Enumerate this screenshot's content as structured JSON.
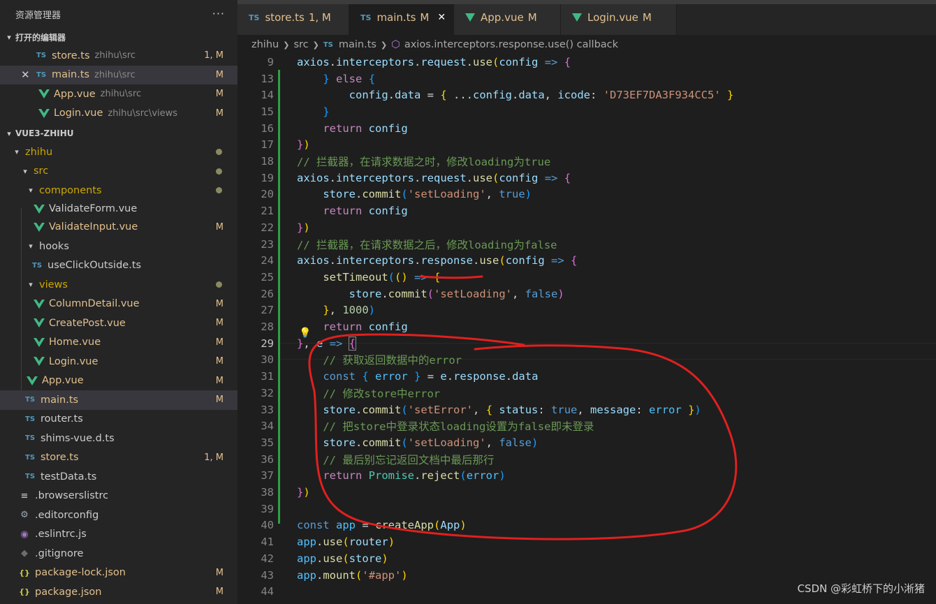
{
  "sidebar": {
    "title": "资源管理器",
    "more": "···",
    "open_editors": {
      "header": "打开的编辑器",
      "items": [
        {
          "type": "TS",
          "name": "store.ts",
          "path": "zhihu\\src",
          "status": "1, M",
          "icon": "ts-icon"
        },
        {
          "type": "TS",
          "name": "main.ts",
          "path": "zhihu\\src",
          "status": "M",
          "icon": "ts-icon",
          "close": "✕"
        },
        {
          "type": "vue",
          "name": "App.vue",
          "path": "zhihu\\src",
          "status": "M",
          "icon": "vue-icon"
        },
        {
          "type": "vue",
          "name": "Login.vue",
          "path": "zhihu\\src\\views",
          "status": "M",
          "icon": "vue-icon"
        }
      ]
    },
    "project": {
      "header": "VUE3-ZHIHU",
      "tree": [
        {
          "label": "zhihu",
          "kind": "folder"
        },
        {
          "label": "src",
          "kind": "folder"
        },
        {
          "label": "components",
          "kind": "folder"
        },
        {
          "label": "ValidateForm.vue",
          "kind": "vue"
        },
        {
          "label": "ValidateInput.vue",
          "kind": "vue",
          "status": "M"
        },
        {
          "label": "hooks",
          "kind": "folder"
        },
        {
          "label": "useClickOutside.ts",
          "kind": "ts"
        },
        {
          "label": "views",
          "kind": "folder"
        },
        {
          "label": "ColumnDetail.vue",
          "kind": "vue",
          "status": "M"
        },
        {
          "label": "CreatePost.vue",
          "kind": "vue",
          "status": "M"
        },
        {
          "label": "Home.vue",
          "kind": "vue",
          "status": "M"
        },
        {
          "label": "Login.vue",
          "kind": "vue",
          "status": "M"
        },
        {
          "label": "App.vue",
          "kind": "vue",
          "status": "M"
        },
        {
          "label": "main.ts",
          "kind": "ts",
          "status": "M"
        },
        {
          "label": "router.ts",
          "kind": "ts"
        },
        {
          "label": "shims-vue.d.ts",
          "kind": "ts"
        },
        {
          "label": "store.ts",
          "kind": "ts",
          "status": "1, M"
        },
        {
          "label": "testData.ts",
          "kind": "ts"
        },
        {
          "label": ".browserslistrc",
          "kind": "lines"
        },
        {
          "label": ".editorconfig",
          "kind": "gear"
        },
        {
          "label": ".eslintrc.js",
          "kind": "eslint"
        },
        {
          "label": ".gitignore",
          "kind": "git"
        },
        {
          "label": "package-lock.json",
          "kind": "json",
          "status": "M"
        },
        {
          "label": "package.json",
          "kind": "json",
          "status": "M"
        }
      ]
    }
  },
  "tabs": [
    {
      "type": "TS",
      "label": "store.ts",
      "status": "1, M"
    },
    {
      "type": "TS",
      "label": "main.ts",
      "status": "M",
      "close": "✕"
    },
    {
      "type": "vue",
      "label": "App.vue",
      "status": "M"
    },
    {
      "type": "vue",
      "label": "Login.vue",
      "status": "M"
    }
  ],
  "breadcrumb": {
    "p1": "zhihu",
    "p2": "src",
    "ts": "TS",
    "p3": "main.ts",
    "p4": "axios.interceptors.response.use() callback"
  },
  "editor": {
    "line_numbers": [
      "9",
      "13",
      "14",
      "15",
      "16",
      "17",
      "18",
      "19",
      "20",
      "21",
      "22",
      "23",
      "24",
      "25",
      "26",
      "27",
      "28",
      "29",
      "30",
      "31",
      "32",
      "33",
      "34",
      "35",
      "36",
      "37",
      "38",
      "39",
      "40",
      "41",
      "42",
      "43",
      "44"
    ],
    "lines": {
      "l9_a": "axios",
      "l9_b": "interceptors",
      "l9_c": "request",
      "l9_d": "use",
      "l9_e": "config",
      "l13_a": "else",
      "l14_a": "config",
      "l14_b": "data",
      "l14_c": "config",
      "l14_d": "data",
      "l14_e": "icode",
      "l14_f": "'D73EF7DA3F934CC5'",
      "l16_a": "return",
      "l16_b": "config",
      "l18": "// 拦截器，在请求数据之时，修改loading为true",
      "l19_a": "axios",
      "l19_b": "interceptors",
      "l19_c": "request",
      "l19_d": "use",
      "l19_e": "config",
      "l20_a": "store",
      "l20_b": "commit",
      "l20_c": "'setLoading'",
      "l20_d": "true",
      "l21_a": "return",
      "l21_b": "config",
      "l23": "// 拦截器，在请求数据之后，修改loading为false",
      "l24_a": "axios",
      "l24_b": "interceptors",
      "l24_c": "response",
      "l24_d": "use",
      "l24_e": "config",
      "l25_a": "setTimeout",
      "l26_a": "store",
      "l26_b": "commit",
      "l26_c": "'setLoading'",
      "l26_d": "false",
      "l27_a": "1000",
      "l28_a": "return",
      "l28_b": "config",
      "l29_a": "e",
      "l30": "// 获取返回数据中的error",
      "l31_a": "const",
      "l31_b": "error",
      "l31_c": "e",
      "l31_d": "response",
      "l31_e": "data",
      "l32": "// 修改store中error",
      "l33_a": "store",
      "l33_b": "commit",
      "l33_c": "'setError'",
      "l33_d": "status",
      "l33_e": "true",
      "l33_f": "message",
      "l33_g": "error",
      "l34": "// 把store中登录状态loading设置为false即未登录",
      "l35_a": "store",
      "l35_b": "commit",
      "l35_c": "'setLoading'",
      "l35_d": "false",
      "l36": "// 最后别忘记返回文档中最后那行",
      "l37_a": "return",
      "l37_b": "Promise",
      "l37_c": "reject",
      "l37_d": "error",
      "l40_a": "const",
      "l40_b": "app",
      "l40_c": "createApp",
      "l40_d": "App",
      "l41_a": "app",
      "l41_b": "use",
      "l41_c": "router",
      "l42_a": "app",
      "l42_b": "use",
      "l42_c": "store",
      "l43_a": "app",
      "l43_b": "mount",
      "l43_c": "'#app'"
    }
  },
  "watermark": "CSDN @彩虹桥下的小淅猪",
  "colors": {
    "background": "#1e1e1e",
    "sidebar": "#252526",
    "modified": "#e2c08d",
    "vue_green": "#41b883",
    "ts_blue": "#519aba",
    "annotation_red": "#e0201f"
  }
}
